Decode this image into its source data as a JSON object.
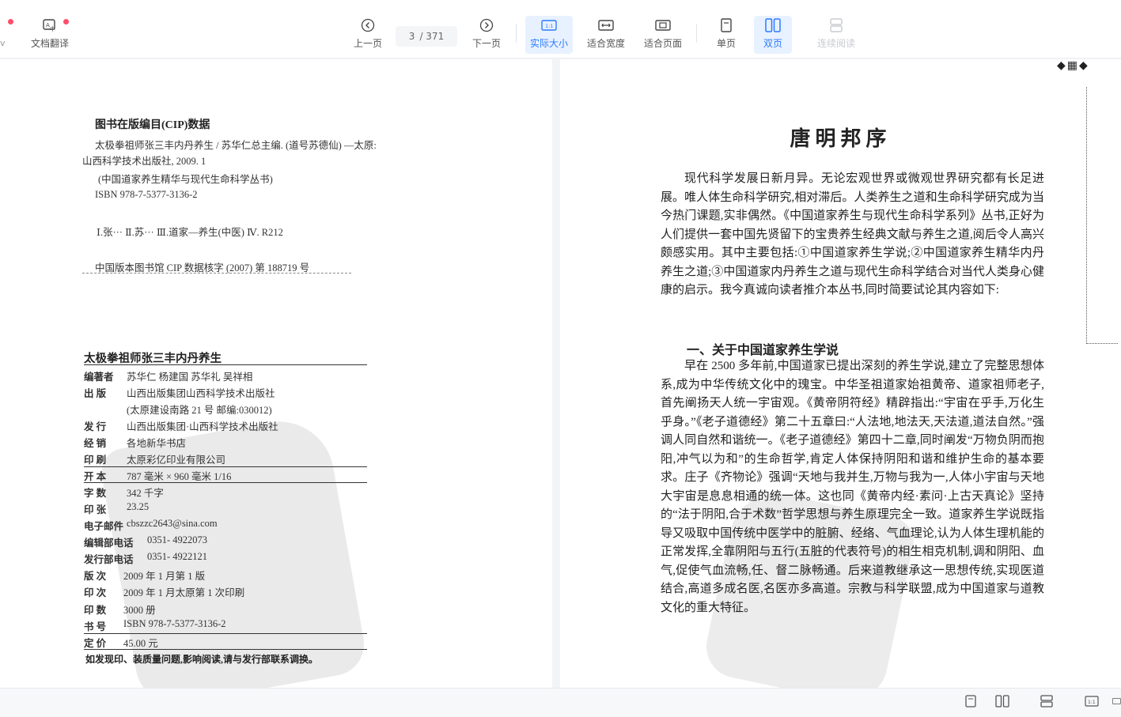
{
  "toolbar": {
    "translate_label": "文档翻译",
    "prev_label": "上一页",
    "current_page": "3",
    "page_total": "/ 371",
    "next_label": "下一页",
    "actual_size_label": "实际大小",
    "fit_width_label": "适合宽度",
    "fit_page_label": "适合页面",
    "single_label": "单页",
    "double_label": "双页",
    "continuous_label": "连续阅读",
    "accent": "#2b7bff"
  },
  "left_page": {
    "cip_title": "图书在版编目(CIP)数据",
    "cip_lines": [
      "太极拳祖师张三丰内丹养生 / 苏华仁总主编. (道号苏德仙) —太原:",
      "山西科学技术出版社, 2009. 1",
      "(中国道家养生精华与现代生命科学丛书)",
      "ISBN 978-7-5377-3136-2",
      "Ⅰ.张···  Ⅱ.苏···  Ⅲ.道家—养生(中医)   Ⅳ. R212",
      "中国版本图书馆 CIP 数据核字 (2007) 第 188719 号"
    ],
    "book_title": "太极拳祖师张三丰内丹养生",
    "info": [
      {
        "k": "编著者",
        "v": "苏华仁   杨建国   苏华礼   吴祥相"
      },
      {
        "k": "出  版",
        "v": "山西出版集团山西科学技术出版社"
      },
      {
        "k": "",
        "v": "(太原建设南路 21 号   邮编:030012)"
      },
      {
        "k": "发  行",
        "v": "山西出版集团·山西科学技术出版社"
      },
      {
        "k": "经  销",
        "v": "各地新华书店"
      },
      {
        "k": "印  刷",
        "v": "太原彩亿印业有限公司"
      },
      {
        "k": "开  本",
        "v": "787 毫米 × 960 毫米    1/16"
      },
      {
        "k": "字  数",
        "v": "342 千字"
      },
      {
        "k": "印  张",
        "v": "23.25"
      },
      {
        "k": "电子邮件",
        "v": "cbszzc2643@sina.com"
      },
      {
        "k": "编辑部电话",
        "v": "0351- 4922073"
      },
      {
        "k": "发行部电话",
        "v": "0351- 4922121"
      },
      {
        "k": "版  次",
        "v": "2009 年 1 月第 1 版"
      },
      {
        "k": "印  次",
        "v": "2009 年 1 月太原第 1 次印刷"
      },
      {
        "k": "印  数",
        "v": "3000 册"
      },
      {
        "k": "书  号",
        "v": "ISBN 978-7-5377-3136-2"
      },
      {
        "k": "定  价",
        "v": "45.00 元"
      }
    ],
    "footer_note": "如发现印、装质量问题,影响阅读,请与发行部联系调换。"
  },
  "right_page": {
    "title": "唐明邦序",
    "para1": "现代科学发展日新月异。无论宏观世界或微观世界研究都有长足进展。唯人体生命科学研究,相对滞后。人类养生之道和生命科学研究成为当今热门课题,实非偶然。《中国道家养生与现代生命科学系列》丛书,正好为人们提供一套中国先贤留下的宝贵养生经典文献与养生之道,阅后令人高兴颇感实用。其中主要包括:①中国道家养生学说;②中国道家养生精华内丹养生之道;③中国道家内丹养生之道与现代生命科学结合对当代人类身心健康的启示。我今真诚向读者推介本丛书,同时简要试论其内容如下:",
    "section_heading": "一、关于中国道家养生学说",
    "para2": "早在 2500 多年前,中国道家已提出深刻的养生学说,建立了完整思想体系,成为中华传统文化中的瑰宝。中华圣祖道家始祖黄帝、道家祖师老子,首先阐扬天人统一宇宙观。《黄帝阴符经》精辟指出:“宇宙在乎手,万化生乎身。”《老子道德经》第二十五章曰:“人法地,地法天,天法道,道法自然。”强调人同自然和谐统一。《老子道德经》第四十二章,同时阐发“万物负阴而抱阳,冲气以为和”的生命哲学,肯定人体保持阴阳和谐和维护生命的基本要求。庄子《齐物论》强调“天地与我并生,万物与我为一,人体小宇宙与天地大宇宙是息息相通的统一体。这也同《黄帝内经·素问·上古天真论》坚持的“法于阴阳,合于术数”哲学思想与养生原理完全一致。道家养生学说既指导又吸取中国传统中医学中的脏腑、经络、气血理论,认为人体生理机能的正常发挥,全靠阴阳与五行(五脏的代表符号)的相生相克机制,调和阴阳、血气,促使气血流畅,任、督二脉畅通。后来道教继承这一思想传统,实现医道结合,高道多成名医,名医亦多高道。宗教与科学联盟,成为中国道家与道教文化的重大特征。"
  }
}
